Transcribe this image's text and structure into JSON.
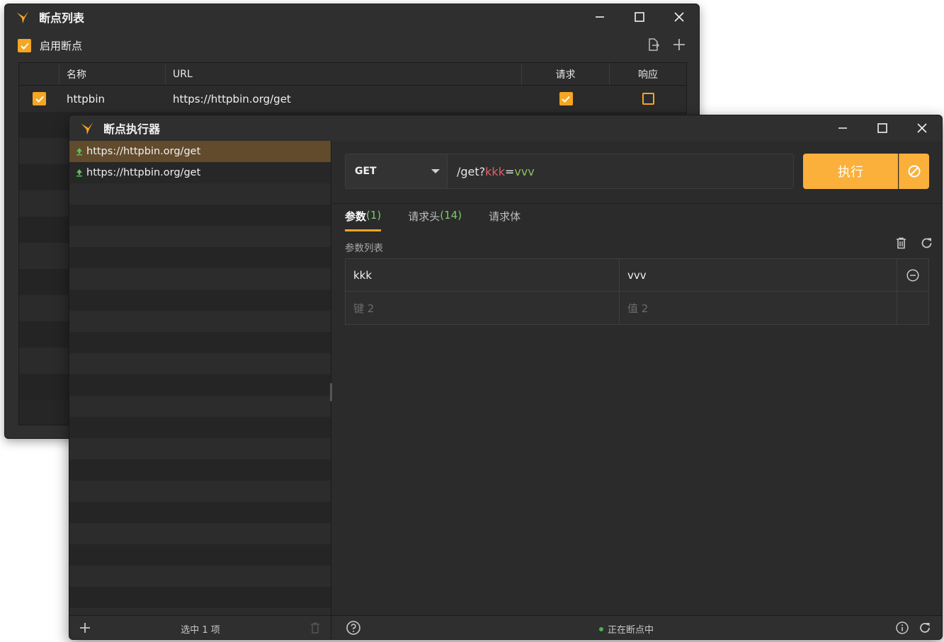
{
  "breakpoint_list_window": {
    "title": "断点列表",
    "enable_checked": true,
    "enable_label": "启用断点",
    "columns": [
      "名称",
      "URL",
      "请求",
      "响应"
    ],
    "rows": [
      {
        "checked": true,
        "name": "httpbin",
        "url": "https://httpbin.org/get",
        "request": true,
        "response": false
      }
    ]
  },
  "executor_window": {
    "title": "断点执行器",
    "requests": [
      {
        "url": "https://httpbin.org/get",
        "selected": true,
        "icon": "upload-arrow-icon"
      },
      {
        "url": "https://httpbin.org/get",
        "selected": false,
        "icon": "upload-arrow-icon"
      }
    ],
    "method": "GET",
    "url_path": "/get?",
    "url_key": "kkk",
    "url_eq": "=",
    "url_value": "vvv",
    "execute_label": "执行",
    "tabs": [
      {
        "label": "参数",
        "count": "(1)",
        "active": true
      },
      {
        "label": "请求头",
        "count": "(14)",
        "active": false
      },
      {
        "label": "请求体",
        "count": "",
        "active": false
      }
    ],
    "params_section_label": "参数列表",
    "params": [
      {
        "key": "kkk",
        "value": "vvv"
      }
    ],
    "new_param": {
      "key_placeholder": "键 2",
      "value_placeholder": "值 2"
    },
    "status": {
      "selection_count": "选中 1 项",
      "state": "正在断点中"
    }
  },
  "colors": {
    "accent": "#f5a623",
    "execute_button": "#fbb03b",
    "selected_row": "#614b2c",
    "url_key": "#e0606a",
    "url_value": "#8fbf5c",
    "tab_count": "#7ec86a",
    "status_dot": "#4caf50",
    "upload_icon": "#5cc35c"
  }
}
